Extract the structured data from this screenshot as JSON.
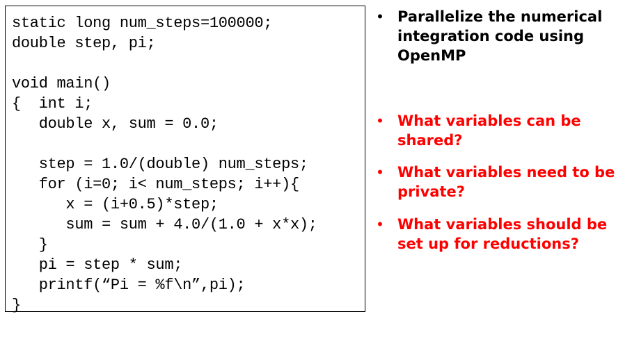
{
  "code": {
    "lines": [
      "static long num_steps=100000;",
      "double step, pi;",
      "",
      "void main()",
      "{  int i;",
      "   double x, sum = 0.0;",
      "",
      "   step = 1.0/(double) num_steps;",
      "   for (i=0; i< num_steps; i++){",
      "      x = (i+0.5)*step;",
      "      sum = sum + 4.0/(1.0 + x*x);",
      "   }",
      "   pi = step * sum;",
      "   printf(“Pi = %f\\n”,pi);",
      "}"
    ]
  },
  "bullets": [
    {
      "marker": "•",
      "text": "Parallelize the numerical integration code using OpenMP",
      "color": "#000000"
    },
    {
      "marker": "•",
      "text": "What variables can be shared?",
      "color": "#ff0000"
    },
    {
      "marker": "•",
      "text": "What variables need to be private?",
      "color": "#ff0000"
    },
    {
      "marker": "•",
      "text": "What variables should be set up for reductions?",
      "color": "#ff0000"
    }
  ]
}
